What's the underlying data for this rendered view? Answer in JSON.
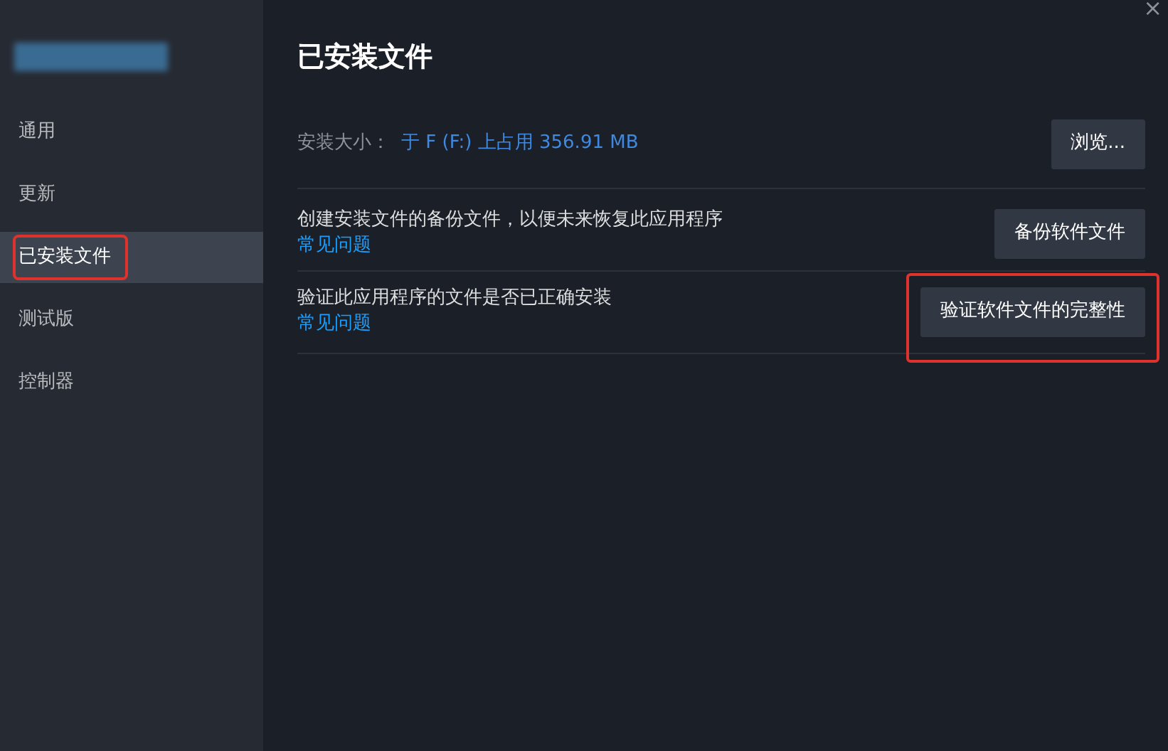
{
  "sidebar": {
    "items": [
      {
        "label": "通用",
        "selected": false,
        "highlighted": false
      },
      {
        "label": "更新",
        "selected": false,
        "highlighted": false
      },
      {
        "label": "已安装文件",
        "selected": true,
        "highlighted": true
      },
      {
        "label": "测试版",
        "selected": false,
        "highlighted": false
      },
      {
        "label": "控制器",
        "selected": false,
        "highlighted": false
      }
    ]
  },
  "close_glyph": "×",
  "title": "已安装文件",
  "size_row": {
    "label": "安装大小：",
    "value": "于 F (F:) 上占用 356.91 MB",
    "button": {
      "label": "浏览...",
      "highlighted": false
    }
  },
  "rows": [
    {
      "text": "创建安装文件的备份文件，以便未来恢复此应用程序",
      "link": "常见问题",
      "button": {
        "label": "备份软件文件",
        "highlighted": false
      }
    },
    {
      "text": "验证此应用程序的文件是否已正确安装",
      "link": "常见问题",
      "button": {
        "label": "验证软件文件的完整性",
        "highlighted": true
      }
    }
  ]
}
